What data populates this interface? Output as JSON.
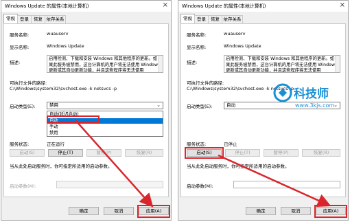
{
  "left_window": {
    "title": "Windows Update 的属性(本地计算机)",
    "close_glyph": "×",
    "tabs": [
      "常规",
      "登录",
      "恢复",
      "依存关系"
    ],
    "service_name_label": "服务名称:",
    "service_name": "wuauserv",
    "display_name_label": "显示名称:",
    "display_name": "Windows Update",
    "description_label": "描述:",
    "description": "启用检测、下载和安装 Windows 和其他程序的更新。如果此服务被禁用，这台计算机的用户将无法使用 Windows 更新或其自动更新功能，并且这些程序将无法使用",
    "exe_path_label": "可执行文件的路径:",
    "exe_path": "C:\\Windows\\system32\\svchost.exe -k netsvcs -p",
    "startup_type_label": "启动类型(E):",
    "startup_type_value": "禁用",
    "startup_options": [
      "自动(延迟启动)",
      "自动",
      "手动",
      "禁用"
    ],
    "startup_selected": "自动",
    "service_status_label": "服务状态:",
    "service_status": "正在运行",
    "btn_start": "启动(S)",
    "btn_stop": "停止(T)",
    "btn_pause": "暂停(P)",
    "btn_resume": "恢复(R)",
    "start_hint": "当从此处启动服务时，你可指定所适用的启动参数。",
    "start_params_label": "启动参数(M):",
    "ok": "确定",
    "cancel": "取消",
    "apply": "应用(A)"
  },
  "right_window": {
    "title": "Windows Update 的属性(本地计算机)",
    "close_glyph": "×",
    "tabs": [
      "常规",
      "登录",
      "恢复",
      "依存关系"
    ],
    "service_name_label": "服务名称:",
    "service_name": "wuauserv",
    "display_name_label": "显示名称:",
    "display_name": "Windows Update",
    "description_label": "描述:",
    "description": "启用检测、下载和安装 Windows 和其他程序的更新。如果此服务被禁用，这台计算机的用户将无法使用 Windows 更新或其自动更新功能，并且这些程序将无法使用",
    "exe_path_label": "可执行文件的路径:",
    "exe_path": "C:\\Windows\\system32\\svchost.exe -k netsvcs -p",
    "startup_type_label": "启动类型(E):",
    "startup_type_value": "自动",
    "service_status_label": "服务状态:",
    "service_status": "已停止",
    "btn_start": "启动(S)",
    "btn_stop": "停止(T)",
    "btn_pause": "暂停(P)",
    "btn_resume": "恢复(R)",
    "start_hint": "当从此处启动服务时，你可指定所适用的启动参数。",
    "start_params_label": "启动参数(M):",
    "ok": "确定",
    "cancel": "取消",
    "apply": "应用(A)"
  },
  "watermark": {
    "title": "科技师",
    "url": "www.3kjs.com"
  },
  "colors": {
    "highlight": "#d9262c",
    "selection": "#0078d7",
    "watermark": "#1a8fd6"
  }
}
